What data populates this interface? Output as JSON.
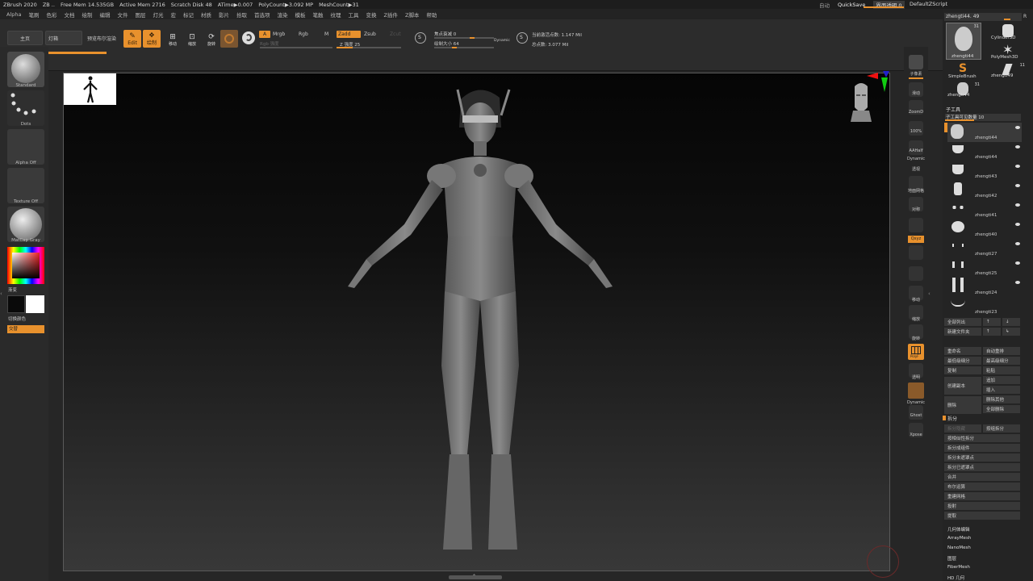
{
  "titlebar": {
    "items": [
      "ZBrush 2020",
      "ZB ..",
      "Free Mem 14.535GB",
      "Active Mem 2716",
      "Scratch Disk 48",
      "ATime▶0.007",
      "PolyCount▶3.092 MP",
      "MeshCount▶31"
    ],
    "right_items": [
      "自动",
      "QuickSave",
      "界面透明 0",
      "DefaultZScript"
    ]
  },
  "menubar": {
    "items": [
      "Alpha",
      "笔刷",
      "色彩",
      "文档",
      "绘制",
      "编辑",
      "文件",
      "图层",
      "灯光",
      "宏",
      "标记",
      "材质",
      "影片",
      "拾取",
      "首选项",
      "渲染",
      "模板",
      "笔触",
      "纹理",
      "工具",
      "变换",
      "Z插件",
      "Z脚本",
      "帮助"
    ]
  },
  "toolbar": {
    "home_label": "主页",
    "lightbox_label": "灯箱",
    "preview_label": "预览布尔渲染",
    "edit_label": "Edit",
    "draw_label": "绘制",
    "move_label": "移动",
    "scale_label": "缩放",
    "rotate_label": "旋转",
    "a_label": "A",
    "mrgb_label": "Mrgb",
    "rgb_label": "Rgb",
    "m_label": "M",
    "zadd_label": "Zadd",
    "zsub_label": "Zsub",
    "zcut_label": "Zcut",
    "rgb_intensity_label": "Rgb 强度",
    "z_intensity_label": "Z 强度 25",
    "focal_label": "焦点衰减 0",
    "draw_size_label": "绘制大小 64",
    "dynamic_label": "Dynamic",
    "active_points_label": "当前激活点数: 1.147 Mil",
    "total_points_label": "总点数: 3.077 Mil"
  },
  "left_shelf": {
    "brush_label": "Standard",
    "stroke_label": "Dots",
    "alpha_label": "Alpha Off",
    "texture_label": "Texture Off",
    "material_label": "MatCap Gray",
    "gradient_label": "渐变",
    "switch_color_label": "切换颜色",
    "alternate_label": "交替"
  },
  "right_shelf": {
    "labels": [
      "子像素",
      "滑动",
      "ZoomD",
      "100%",
      "AAHalf",
      "Dynamic",
      "透视",
      "地面网格",
      "对称",
      "Qxyz",
      "移动",
      "缩放",
      "旋转",
      "PolyF",
      "透明",
      "Dynamic",
      "Ghost",
      "Solo",
      "Xpose"
    ]
  },
  "right_panel": {
    "current_tool": "zhengti44. 49",
    "r_label": "R",
    "tool_count": "31",
    "thumbs": [
      {
        "name": "zhengti44"
      },
      {
        "name": "Cylinder3D"
      },
      {
        "name": "PolyMesh3D"
      },
      {
        "name": "SimpleBrush"
      },
      {
        "name": "zhengti49"
      },
      {
        "name": "zhengti44"
      }
    ],
    "thumb_counts": [
      "11",
      "31"
    ],
    "subtool_title": "子工具",
    "visible_count_label": "子工具可见数量 10",
    "subtools": [
      "zhengti44",
      "zhengti44",
      "zhengti43",
      "zhengti42",
      "zhengti41",
      "zhengti40",
      "zhengti27",
      "zhengti25",
      "zhengti24",
      "zhengti23"
    ],
    "list_all": "全部列出",
    "new_folder": "新建文件夹",
    "rename": "重命名",
    "auto_reorder": "自动重排",
    "lowest_res": "最低级细分",
    "highest_res": "最高级细分",
    "copy": "复制",
    "paste": "粘贴",
    "append": "追加",
    "duplicate": "创建副本",
    "insert": "插入",
    "delete": "删除",
    "delete_other": "删除其他",
    "delete_all": "全部删除",
    "split_title": "拆分",
    "split_hidden": "拆分隐藏",
    "group_split": "按组拆分",
    "split_similar": "按相似性拆分",
    "split_to_parts": "拆分成组件",
    "split_unmasked": "拆分未遮罩点",
    "split_masked": "拆分已遮罩点",
    "merge": "合并",
    "boolean": "布尔运算",
    "remesh": "重建网格",
    "project": "投射",
    "extract": "提取",
    "geometry_edit": "几何体编辑",
    "arraymesh": "ArrayMesh",
    "nanomesh": "NanoMesh",
    "layers": "图层",
    "fibermesh": "FiberMesh",
    "hd_geometry": "HD 几何"
  },
  "colors": {
    "accent": "#e8912d",
    "bg": "#262626"
  }
}
